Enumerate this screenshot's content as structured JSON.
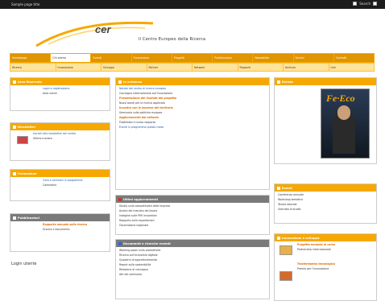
{
  "topbar": {
    "left": "Sample page title",
    "right_items": [
      "Search",
      ""
    ]
  },
  "header": {
    "logo": "cer",
    "tagline": "Il Centro Europeo della Ricerca"
  },
  "nav1": [
    "Homepage",
    "Chi siamo",
    "Eventi",
    "Formazione",
    "Progetti",
    "Pubblicazioni",
    "Newsletter",
    "Servizi",
    "Contatti"
  ],
  "nav2": [
    "Ricerca",
    "Innovazione",
    "Sviluppo",
    "Partner",
    "Network",
    "Rapporti",
    "Archivio",
    "Link"
  ],
  "left": {
    "p1": {
      "title": "Area Riservata",
      "lines": [
        "Login e registrazione",
        "Area utenti"
      ]
    },
    "p2": {
      "title": "Newsletter",
      "lines": [
        "Iscriviti alla newsletter del centro",
        "Ultimo numero"
      ]
    },
    "p3": {
      "title": "Formazione",
      "lines": [
        "Corsi e seminari in programma",
        "Calendario"
      ]
    },
    "p4": {
      "title": "Pubblicazioni",
      "lines": [
        "Rapporto annuale sulla ricerca",
        "Scarica il documento"
      ]
    },
    "p5": {
      "title": "Login utente"
    }
  },
  "center": {
    "p1": {
      "title": "In evidenza",
      "lines": [
        "Notizie dal centro di ricerca europeo",
        "Convegno internazionale sull'innovazione",
        "Presentazione dei risultati del progetto",
        "Nuovi bandi per la ricerca applicata",
        "Incontro con le imprese del territorio",
        "Seminario sulle politiche europee",
        "Aggiornamenti dal network",
        "Pubblicato il nuovo rapporto",
        "Eventi in programma questo mese"
      ]
    },
    "p2": {
      "title": "Ultimi aggiornamenti",
      "lines": [
        "Studio sulla competitività delle imprese",
        "Analisi del mercato del lavoro",
        "Indagine sulle PMI innovative",
        "Rapporto sulle esportazioni",
        "Osservatorio regionale",
        "Dati statistici trimestrali",
        "Nota congiunturale",
        "Approfondimenti tematici"
      ]
    },
    "p3": {
      "title": "Documenti e ricerche recenti",
      "lines": [
        "Working paper sulla produttività",
        "Ricerca sull'economia digitale",
        "Quaderni di approfondimento",
        "Report sulla sostenibilità",
        "Relazione al convegno",
        "Atti del seminario"
      ]
    }
  },
  "right": {
    "p1": {
      "title": "Rivista"
    },
    "mag_title": "Fe·Eco",
    "p2": {
      "title": "Eventi",
      "lines": [
        "Conferenza annuale",
        "Workshop tematico",
        "Tavola rotonda",
        "Giornata di studio"
      ]
    },
    "p3": {
      "title": "Innovazione e sviluppo",
      "lines": [
        "Progetto europeo in corso",
        "Partnership internazionale",
        "Trasferimento tecnologico",
        "Premio per l'innovazione"
      ]
    }
  }
}
